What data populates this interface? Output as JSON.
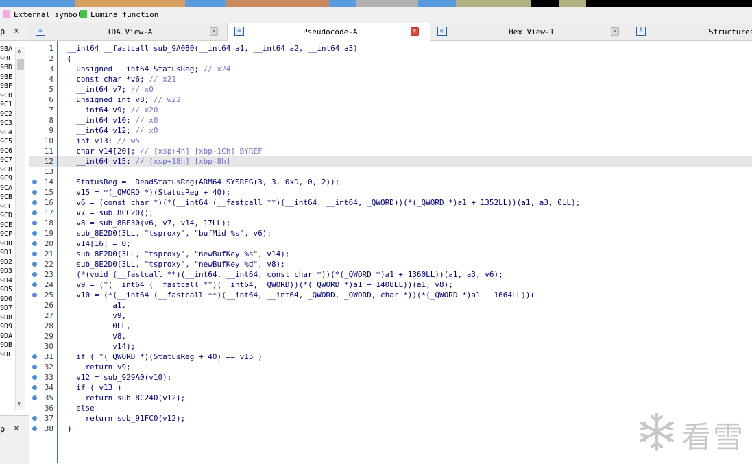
{
  "legend": {
    "external_symbol": {
      "label": "External symbol",
      "color": "#f7a8e0"
    },
    "lumina_function": {
      "label": "Lumina function",
      "color": "#44c444"
    }
  },
  "tabs": [
    {
      "label": "IDA View-A",
      "icon": "ida-view-icon",
      "active": false,
      "close": "×"
    },
    {
      "label": "Pseudocode-A",
      "icon": "pseudocode-icon",
      "active": true,
      "close": "×"
    },
    {
      "label": "Hex View-1",
      "icon": "hex-view-icon",
      "active": false,
      "close": "×"
    },
    {
      "label": "Structures",
      "icon": "structures-icon",
      "active": false
    }
  ],
  "left_panel": {
    "header_glyph": "p",
    "close": "×",
    "addresses": [
      "9BA",
      "9BC",
      "9BD",
      "9BE",
      "9BF",
      "9C0",
      "9C1",
      "9C2",
      "9C3",
      "9C4",
      "9C5",
      "9C6",
      "9C7",
      "9C8",
      "9C9",
      "9CA",
      "9CB",
      "9CC",
      "9CD",
      "9CE",
      "9CF",
      "9D0",
      "9D1",
      "9D2",
      "9D3",
      "9D4",
      "9D5",
      "9D6",
      "9D7",
      "9D8",
      "9D9",
      "9DA",
      "9DB",
      "9DC"
    ],
    "footer_glyph": "p",
    "footer_close": "×"
  },
  "code": [
    {
      "n": "1",
      "text": "__int64 __fastcall sub_9A080(__int64 a1, __int64 a2, __int64 a3)",
      "bp": false
    },
    {
      "n": "2",
      "text": "{",
      "bp": false
    },
    {
      "n": "3",
      "text": "  unsigned __int64 StatusReg; // x24",
      "bp": false
    },
    {
      "n": "4",
      "text": "  const char *v6; // x21",
      "bp": false
    },
    {
      "n": "5",
      "text": "  __int64 v7; // x0",
      "bp": false
    },
    {
      "n": "6",
      "text": "  unsigned int v8; // w22",
      "bp": false
    },
    {
      "n": "7",
      "text": "  __int64 v9; // x20",
      "bp": false
    },
    {
      "n": "8",
      "text": "  __int64 v10; // x0",
      "bp": false
    },
    {
      "n": "9",
      "text": "  __int64 v12; // x0",
      "bp": false
    },
    {
      "n": "10",
      "text": "  int v13; // w5",
      "bp": false
    },
    {
      "n": "11",
      "text": "  char v14[20]; // [xsp+4h] [xbp-1Ch] BYREF",
      "bp": false
    },
    {
      "n": "12",
      "text": "  __int64 v15; // [xsp+18h] [xbp-8h]",
      "bp": false,
      "hl": true
    },
    {
      "n": "13",
      "text": "",
      "bp": false
    },
    {
      "n": "14",
      "text": "  StatusReg = _ReadStatusReg(ARM64_SYSREG(3, 3, 0xD, 0, 2));",
      "bp": true
    },
    {
      "n": "15",
      "text": "  v15 = *(_QWORD *)(StatusReg + 40);",
      "bp": true
    },
    {
      "n": "16",
      "text": "  v6 = (const char *)(*(__int64 (__fastcall **)(__int64, __int64, _QWORD))(*(_QWORD *)a1 + 1352LL))(a1, a3, 0LL);",
      "bp": true
    },
    {
      "n": "17",
      "text": "  v7 = sub_8CC20();",
      "bp": true
    },
    {
      "n": "18",
      "text": "  v8 = sub_8BE30(v6, v7, v14, 17LL);",
      "bp": true
    },
    {
      "n": "19",
      "text": "  sub_8E2D0(3LL, \"tsproxy\", \"bufMid %s\", v6);",
      "bp": true
    },
    {
      "n": "20",
      "text": "  v14[16] = 0;",
      "bp": true
    },
    {
      "n": "21",
      "text": "  sub_8E2D0(3LL, \"tsproxy\", \"newBufKey %s\", v14);",
      "bp": true
    },
    {
      "n": "22",
      "text": "  sub_8E2D0(3LL, \"tsproxy\", \"newBufKey %d\", v8);",
      "bp": true
    },
    {
      "n": "23",
      "text": "  (*(void (__fastcall **)(__int64, __int64, const char *))(*(_QWORD *)a1 + 1360LL))(a1, a3, v6);",
      "bp": true
    },
    {
      "n": "24",
      "text": "  v9 = (*(__int64 (__fastcall **)(__int64, _QWORD))(*(_QWORD *)a1 + 1408LL))(a1, v8);",
      "bp": true
    },
    {
      "n": "25",
      "text": "  v10 = (*(__int64 (__fastcall **)(__int64, __int64, _QWORD, _QWORD, char *))(*(_QWORD *)a1 + 1664LL))(",
      "bp": true
    },
    {
      "n": "26",
      "text": "          a1,",
      "bp": false
    },
    {
      "n": "27",
      "text": "          v9,",
      "bp": false
    },
    {
      "n": "28",
      "text": "          0LL,",
      "bp": false
    },
    {
      "n": "29",
      "text": "          v8,",
      "bp": false
    },
    {
      "n": "30",
      "text": "          v14);",
      "bp": false
    },
    {
      "n": "31",
      "text": "  if ( *(_QWORD *)(StatusReg + 40) == v15 )",
      "bp": true
    },
    {
      "n": "32",
      "text": "    return v9;",
      "bp": true
    },
    {
      "n": "33",
      "text": "  v12 = sub_929A0(v10);",
      "bp": true
    },
    {
      "n": "34",
      "text": "  if ( v13 )",
      "bp": true
    },
    {
      "n": "35",
      "text": "    return sub_8C240(v12);",
      "bp": true
    },
    {
      "n": "36",
      "text": "  else",
      "bp": false
    },
    {
      "n": "37",
      "text": "    return sub_91FC0(v12);",
      "bp": true
    },
    {
      "n": "38",
      "text": "}",
      "bp": true
    }
  ],
  "watermark": {
    "text": "看雪",
    "icon": "snowflake-icon"
  }
}
